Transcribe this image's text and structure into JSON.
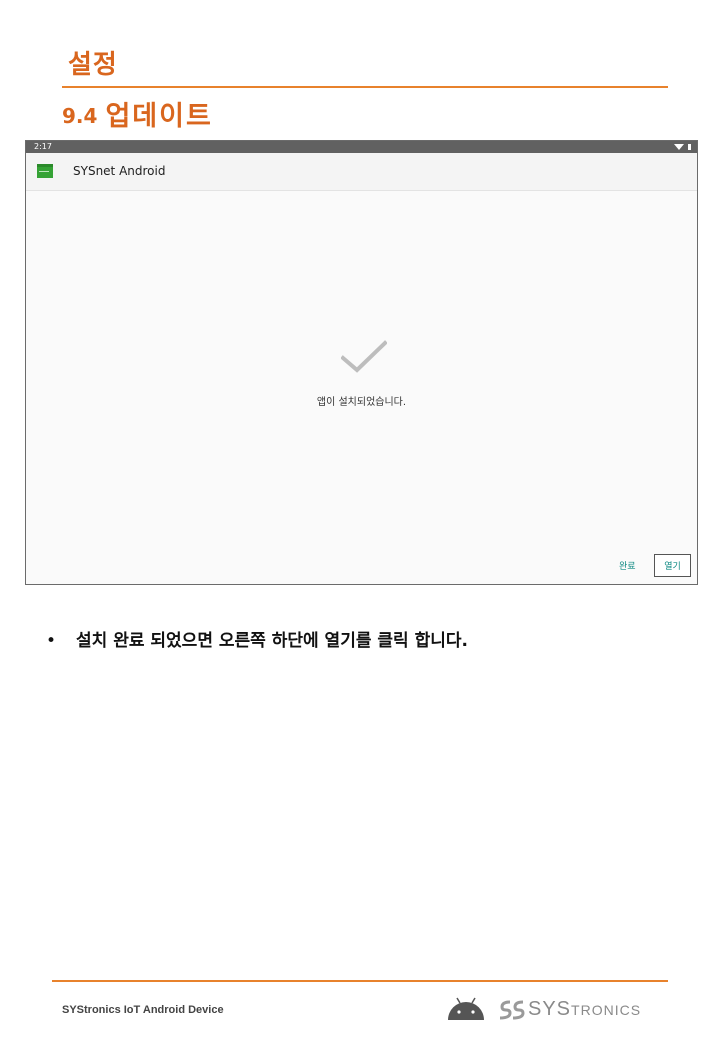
{
  "header": {
    "section_title": "설정",
    "subsection_number": "9.4",
    "subsection_title": "업데이트"
  },
  "device": {
    "status_time": "2:17",
    "app_title": "SYSnet Android",
    "install_message": "앱이 설치되었습니다.",
    "done_label": "완료",
    "open_label": "열기"
  },
  "instruction": {
    "bullet": "•",
    "text": "설치 완료 되었으면 오른쪽 하단에 열기를 클릭 합니다."
  },
  "footer": {
    "company": "SYStronics IoT Android Device",
    "brand_big": "SYS",
    "brand_small": "TRONICS"
  },
  "colors": {
    "accent": "#e8822c",
    "heading": "#d9661e",
    "button_text": "#0f8a83"
  }
}
